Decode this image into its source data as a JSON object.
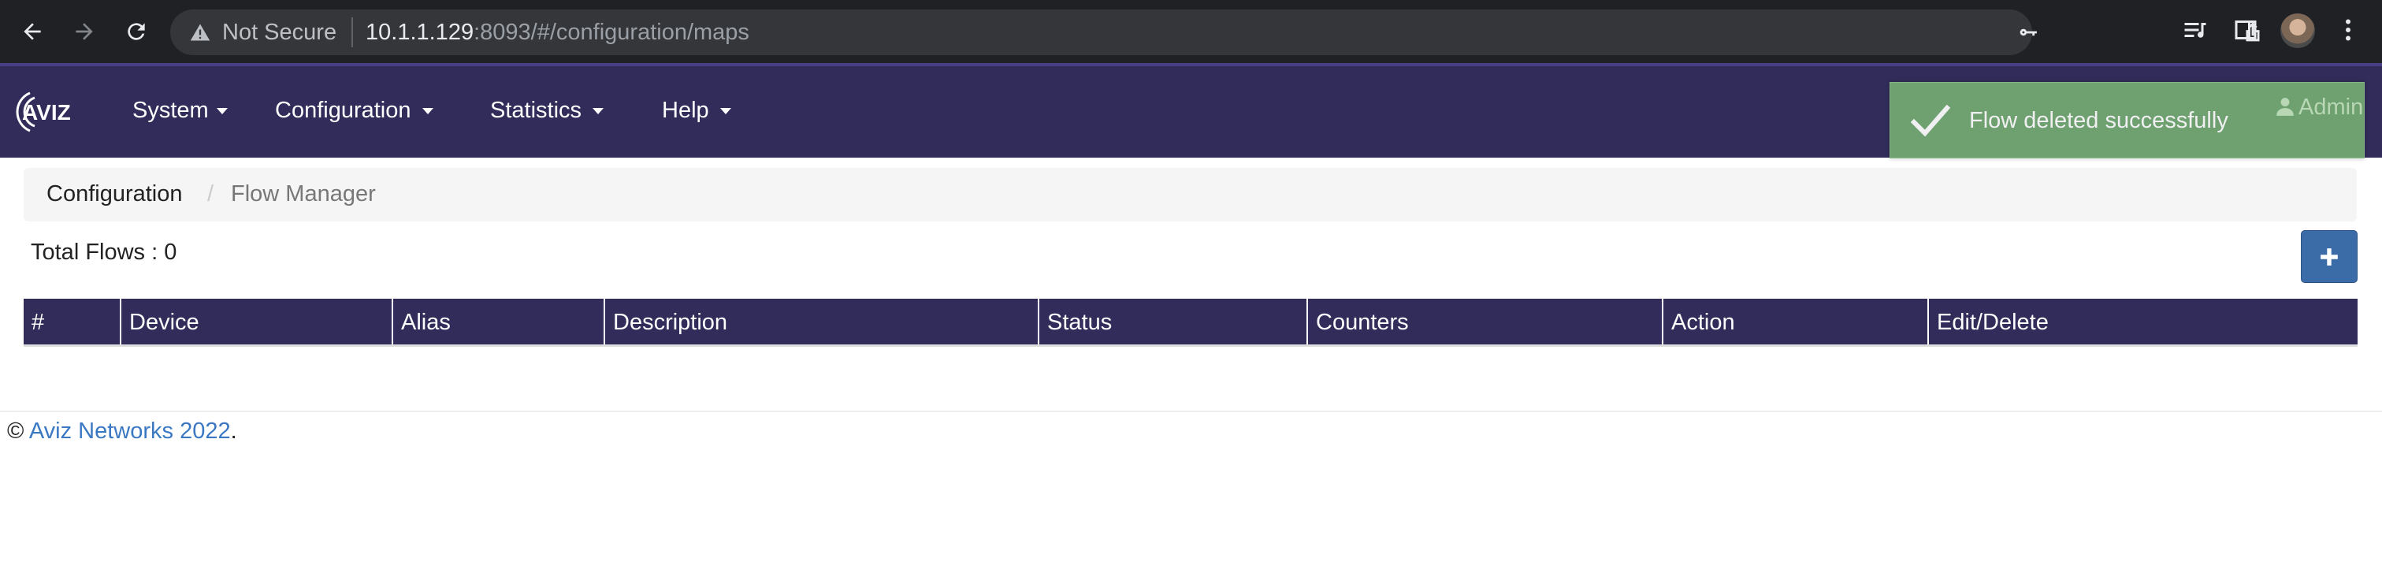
{
  "browser": {
    "security_label": "Not Secure",
    "url_host": "10.1.1.129",
    "url_rest": ":8093/#/configuration/maps"
  },
  "navbar": {
    "logo_text": "AVIZ",
    "items": [
      {
        "label": "System"
      },
      {
        "label": "Configuration"
      },
      {
        "label": "Statistics"
      },
      {
        "label": "Help"
      }
    ],
    "user_label": "Admin"
  },
  "toast": {
    "message": "Flow deleted successfully",
    "color": "#74a971"
  },
  "breadcrumb": {
    "items": [
      "Configuration",
      "Flow Manager"
    ],
    "separator": "/"
  },
  "flows": {
    "total_label": "Total Flows : 0",
    "add_icon": "plus-icon",
    "columns": [
      "#",
      "Device",
      "Alias",
      "Description",
      "Status",
      "Counters",
      "Action",
      "Edit/Delete"
    ],
    "rows": []
  },
  "footer": {
    "prefix": "©",
    "link_text": "Aviz Networks 2022",
    "suffix": "."
  },
  "colors": {
    "navbar": "#322c5a",
    "accent_button": "#3b6ca8",
    "link": "#3a78c3"
  }
}
